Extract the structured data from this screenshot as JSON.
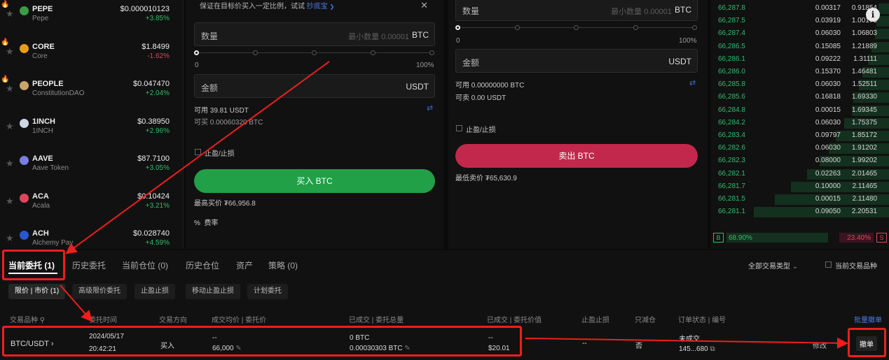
{
  "markets": [
    {
      "symbol": "PEPE",
      "name": "Pepe",
      "price": "$0.000010123",
      "change": "+3.85%",
      "dir": "up",
      "coin_color": "#3d9b45",
      "hot": true
    },
    {
      "symbol": "CORE",
      "name": "Core",
      "price": "$1.8499",
      "change": "-1.62%",
      "dir": "down",
      "coin_color": "#e79c1a",
      "hot": true
    },
    {
      "symbol": "PEOPLE",
      "name": "ConstitutionDAO",
      "price": "$0.047470",
      "change": "+2.04%",
      "dir": "up",
      "coin_color": "#c9a46a",
      "hot": true
    },
    {
      "symbol": "1INCH",
      "name": "1INCH",
      "price": "$0.38950",
      "change": "+2.96%",
      "dir": "up",
      "coin_color": "#cfd6e6",
      "hot": false
    },
    {
      "symbol": "AAVE",
      "name": "Aave Token",
      "price": "$87.7100",
      "change": "+3.05%",
      "dir": "up",
      "coin_color": "#7a7ee0",
      "hot": false
    },
    {
      "symbol": "ACA",
      "name": "Acala",
      "price": "$0.10424",
      "change": "+3.21%",
      "dir": "up",
      "coin_color": "#e0445c",
      "hot": false
    },
    {
      "symbol": "ACH",
      "name": "Alchemy Pay",
      "price": "$0.028740",
      "change": "+4.59%",
      "dir": "up",
      "coin_color": "#2b56d0",
      "hot": false
    }
  ],
  "buy": {
    "notice": "保证在目标价买入一定比例，试试",
    "notice_link": "抄底宝",
    "notice_link_arrow": "❯",
    "qty_label": "数量",
    "qty_placeholder": "最小数量 0.00001",
    "qty_unit": "BTC",
    "slider_min": "0",
    "slider_max": "100%",
    "amount_label": "金额",
    "amount_unit": "USDT",
    "available": "可用 39.81 USDT",
    "can_buy": "可买 0.00060320 BTC",
    "tpsl": "止盈/止损",
    "button": "买入 BTC",
    "best_price": "最高买价 ₮66,956.8",
    "fee": "费率",
    "fee_icon": "%"
  },
  "sell": {
    "qty_label": "数量",
    "qty_placeholder": "最小数量 0.00001",
    "qty_unit": "BTC",
    "slider_min": "0",
    "slider_max": "100%",
    "amount_label": "金额",
    "amount_unit": "USDT",
    "available": "可用 0.00000000 BTC",
    "can_sell": "可卖 0.00 USDT",
    "tpsl": "止盈/止损",
    "button": "卖出 BTC",
    "best_price": "最低卖价 ₮65,630.9"
  },
  "orderbook": {
    "rows": [
      {
        "price": "66,287.8",
        "qty": "0.00317",
        "total": "0.91854",
        "fill": 0.06
      },
      {
        "price": "66,287.5",
        "qty": "0.03919",
        "total": "1.00173",
        "fill": 0.07
      },
      {
        "price": "66,287.4",
        "qty": "0.06030",
        "total": "1.06803",
        "fill": 0.08
      },
      {
        "price": "66,286.5",
        "qty": "0.15085",
        "total": "1.21889",
        "fill": 0.1
      },
      {
        "price": "66,286.1",
        "qty": "0.09222",
        "total": "1.31111",
        "fill": 0.12
      },
      {
        "price": "66,286.0",
        "qty": "0.15370",
        "total": "1.46481",
        "fill": 0.15
      },
      {
        "price": "66,285.8",
        "qty": "0.06030",
        "total": "1.52511",
        "fill": 0.17
      },
      {
        "price": "66,285.6",
        "qty": "0.16818",
        "total": "1.69330",
        "fill": 0.2
      },
      {
        "price": "66,284.8",
        "qty": "0.00015",
        "total": "1.69345",
        "fill": 0.21
      },
      {
        "price": "66,284.2",
        "qty": "0.06030",
        "total": "1.75375",
        "fill": 0.25
      },
      {
        "price": "66,283.4",
        "qty": "0.09797",
        "total": "1.85172",
        "fill": 0.3
      },
      {
        "price": "66,282.6",
        "qty": "0.06030",
        "total": "1.91202",
        "fill": 0.34
      },
      {
        "price": "66,282.3",
        "qty": "0.08000",
        "total": "1.99202",
        "fill": 0.39
      },
      {
        "price": "66,282.1",
        "qty": "0.02263",
        "total": "2.01465",
        "fill": 0.46
      },
      {
        "price": "66,281.7",
        "qty": "0.10000",
        "total": "2.11465",
        "fill": 0.55
      },
      {
        "price": "66,281.5",
        "qty": "0.00015",
        "total": "2.11480",
        "fill": 0.64
      },
      {
        "price": "66,281.1",
        "qty": "0.09050",
        "total": "2.20531",
        "fill": 0.76
      }
    ],
    "buy_ratio_label": "B",
    "buy_ratio": "68.90%",
    "sell_ratio": "23.40%",
    "sell_ratio_label": "S",
    "info_icon": "i"
  },
  "orders": {
    "tabs": [
      "当前委托 (1)",
      "历史委托",
      "当前仓位 (0)",
      "历史仓位",
      "资产",
      "策略 (0)"
    ],
    "filter_type": "全部交易类型",
    "current_pair_only": "当前交易品种",
    "chips": [
      "限价 | 市价 (1)",
      "高级限价委托",
      "止盈止损",
      "移动止盈止损",
      "计划委托"
    ],
    "headers": [
      "交易品种",
      "委托时间",
      "交易方向",
      "成交均价 | 委托价",
      "已成交 | 委托总量",
      "已成交 | 委托价值",
      "止盈止损",
      "只减仓",
      "订单状态 | 编号"
    ],
    "batch_cancel": "批量撤单",
    "row": {
      "pair": "BTC/USDT",
      "date": "2024/05/17",
      "time": "20:42:21",
      "side": "买入",
      "avg_price": "--",
      "order_price": "66,000",
      "filled": "0 BTC",
      "total_qty": "0.00030303 BTC",
      "filled_value": "--",
      "order_value": "$20.01",
      "tpsl": "--",
      "reduce_only": "否",
      "status": "未成交",
      "order_id": "145...680",
      "modify": "修改",
      "cancel": "撤单"
    }
  },
  "colors": {
    "buy_green": "#21a047",
    "sell_red": "#c2284b",
    "highlight_red": "#f01e1e",
    "link_blue": "#3b6bd6"
  }
}
